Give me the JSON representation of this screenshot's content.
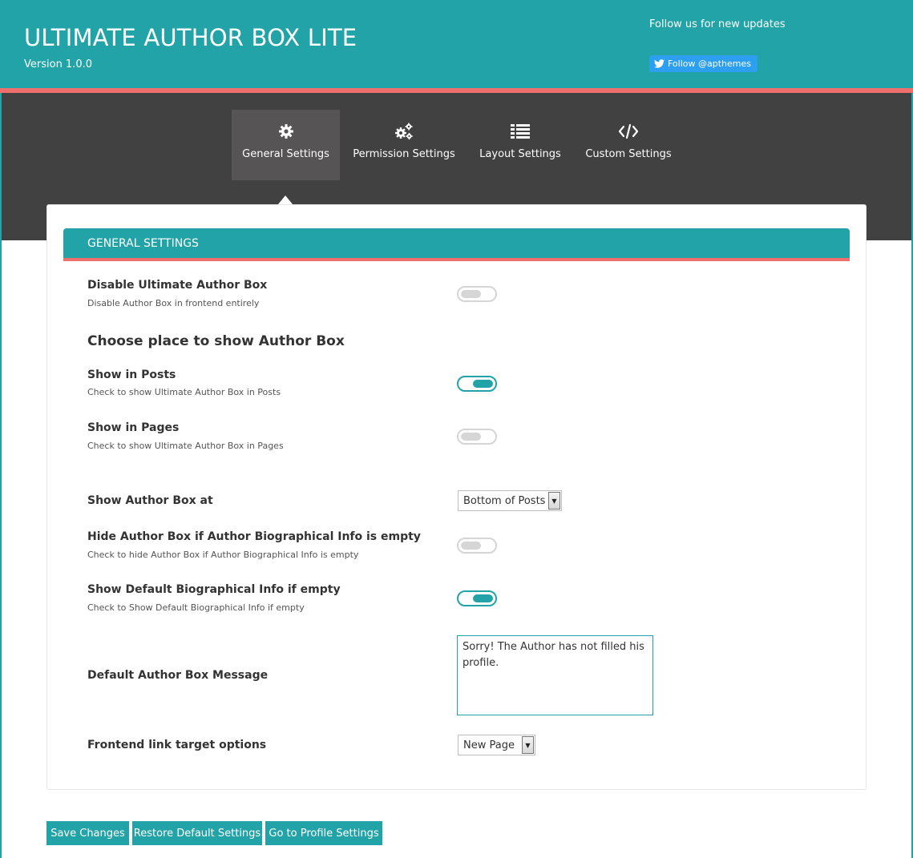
{
  "header": {
    "title": "ULTIMATE AUTHOR BOX LITE",
    "version": "Version 1.0.0",
    "follow_text": "Follow us for new updates",
    "follow_button": "Follow @apthemes"
  },
  "tabs": [
    {
      "label": "General Settings",
      "icon": "gear-icon",
      "active": true
    },
    {
      "label": "Permission Settings",
      "icon": "gears-icon",
      "active": false
    },
    {
      "label": "Layout Settings",
      "icon": "list-icon",
      "active": false
    },
    {
      "label": "Custom Settings",
      "icon": "code-icon",
      "active": false
    }
  ],
  "section": {
    "title": "GENERAL SETTINGS"
  },
  "settings": {
    "disable": {
      "label": "Disable Ultimate Author Box",
      "desc": "Disable Author Box in frontend entirely",
      "enabled": false
    },
    "choose_place": "Choose place to show Author Box",
    "show_posts": {
      "label": "Show in Posts",
      "desc": "Check to show Ultimate Author Box in Posts",
      "enabled": true
    },
    "show_pages": {
      "label": "Show in Pages",
      "desc": "Check to show Ultimate Author Box in Pages",
      "enabled": false
    },
    "show_at": {
      "label": "Show Author Box at",
      "value": "Bottom of Posts"
    },
    "hide_if_empty": {
      "label": "Hide Author Box if Author Biographical Info is empty",
      "desc": "Check to hide Author Box if Author Biographical Info is empty",
      "enabled": false
    },
    "default_bio": {
      "label": "Show Default Biographical Info if empty",
      "desc": "Check to Show Default Biographical Info if empty",
      "enabled": true
    },
    "default_message": {
      "label": "Default Author Box Message",
      "value": "Sorry! The Author has not filled his profile."
    },
    "link_target": {
      "label": "Frontend link target options",
      "value": "New Page"
    }
  },
  "buttons": {
    "save": "Save Changes",
    "restore": "Restore Default Settings",
    "profile": "Go to Profile Settings"
  },
  "colors": {
    "primary": "#22a3a8",
    "accent": "#ef6f6c",
    "dark": "#414141",
    "twitter": "#2c9ff0"
  }
}
